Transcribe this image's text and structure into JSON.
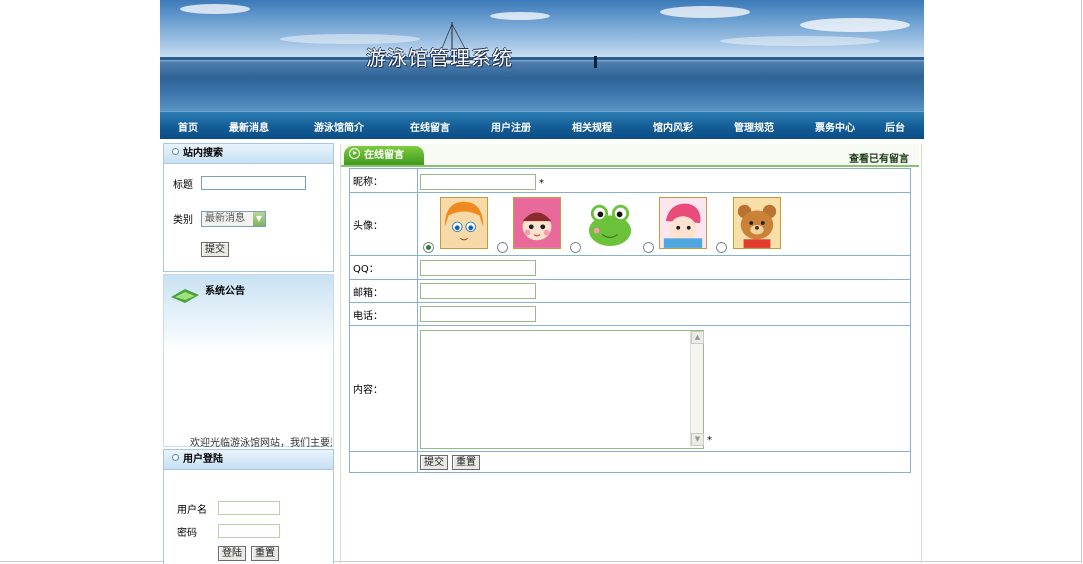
{
  "site": {
    "title": "游泳馆管理系统"
  },
  "nav": [
    "首页",
    "最新消息",
    "游泳馆简介",
    "在线留言",
    "用户注册",
    "相关规程",
    "馆内风彩",
    "管理规范",
    "票务中心",
    "后台"
  ],
  "search": {
    "heading": "站内搜索",
    "title_label": "标题",
    "title_value": "",
    "category_label": "类别",
    "category_value": "最新消息",
    "submit_label": "提交"
  },
  "notice": {
    "heading": "系统公告",
    "marquee": "欢迎光临游泳馆网站，我们主要是"
  },
  "login": {
    "heading": "用户登陆",
    "username_label": "用户名",
    "password_label": "密码",
    "login_label": "登陆",
    "reset_label": "重置"
  },
  "guestbook": {
    "tab_label": "在线留言",
    "view_link": "查看已有留言",
    "nickname_label": "昵称：",
    "avatar_label": "头像：",
    "qq_label": "QQ：",
    "email_label": "邮箱：",
    "phone_label": "电话：",
    "content_label": "内容：",
    "required_mark": "*",
    "submit_label": "提交",
    "reset_label": "重置",
    "selected_avatar": 1,
    "avatars": [
      "anime-girl-avatar",
      "pink-hood-girl-avatar",
      "green-frog-avatar",
      "pink-hair-boy-avatar",
      "brown-bear-avatar"
    ]
  },
  "colors": {
    "nav_bg": "#145d97",
    "tab_green": "#4fab26",
    "border_blue": "#8ab1cc"
  }
}
